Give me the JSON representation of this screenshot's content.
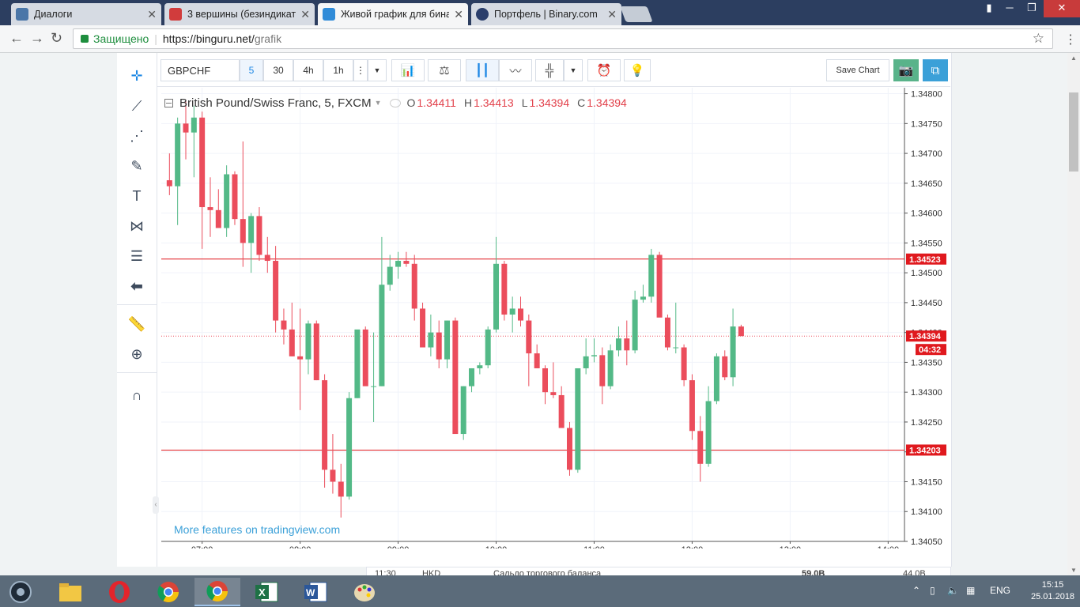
{
  "browser": {
    "tabs": [
      {
        "title": "Диалоги",
        "color": "#4a76a8",
        "active": false
      },
      {
        "title": "3 вершины (безиндикат",
        "color": "#d13c3c",
        "active": false
      },
      {
        "title": "Живой график для бина",
        "color": "#2f8bd8",
        "active": true
      },
      {
        "title": "Портфель | Binary.com",
        "color": "#2a3e6b",
        "active": false
      }
    ],
    "secure_label": "Защищено",
    "url_base": "https://binguru.net/",
    "url_path": "grafik"
  },
  "toolbar": {
    "symbol": "GBPCHF",
    "resolutions": [
      "5",
      "30",
      "4h",
      "1h"
    ],
    "active_resolution": "5",
    "save_chart_label": "Save Chart"
  },
  "legend": {
    "title": "British Pound/Swiss Franc, 5, FXCM",
    "o_label": "O",
    "o_value": "1.34411",
    "h_label": "H",
    "h_value": "1.34413",
    "l_label": "L",
    "l_value": "1.34394",
    "c_label": "C",
    "c_value": "1.34394"
  },
  "tradingview_link": "More features on tradingview.com",
  "bottom_strip": {
    "time": "11:30",
    "currency": "HKD",
    "text": "Сальдо торгового баланса",
    "v1": "59.0B",
    "v2": "44.0B"
  },
  "taskbar": {
    "lang": "ENG",
    "time": "15:15",
    "date": "25.01.2018"
  },
  "chart_data": {
    "type": "candlestick",
    "symbol": "GBPCHF",
    "interval": "5",
    "ylim": [
      1.3405,
      1.3481
    ],
    "xlim": [
      "06:35",
      "14:10"
    ],
    "y_ticks": [
      "1.34800",
      "1.34750",
      "1.34700",
      "1.34650",
      "1.34600",
      "1.34550",
      "1.34500",
      "1.34450",
      "1.34400",
      "1.34350",
      "1.34300",
      "1.34250",
      "1.34200",
      "1.34150",
      "1.34100",
      "1.34050"
    ],
    "x_ticks": [
      "07:00",
      "08:00",
      "09:00",
      "10:00",
      "11:00",
      "12:00",
      "13:00",
      "14:00"
    ],
    "grid": true,
    "colors": {
      "up": "#53b987",
      "down": "#eb4d5c",
      "level": "#e0191e",
      "price_badge": "#e0191e"
    },
    "horizontal_levels": [
      {
        "price": 1.34523,
        "label": "1.34523"
      },
      {
        "price": 1.34203,
        "label": "1.34203"
      }
    ],
    "last_price": {
      "price": 1.34394,
      "label": "1.34394",
      "countdown": "04:32"
    },
    "candles": [
      {
        "t": "06:40",
        "o": 1.34655,
        "h": 1.347,
        "l": 1.3463,
        "c": 1.34645
      },
      {
        "t": "06:45",
        "o": 1.34645,
        "h": 1.3476,
        "l": 1.3458,
        "c": 1.3475
      },
      {
        "t": "06:50",
        "o": 1.3475,
        "h": 1.3479,
        "l": 1.3469,
        "c": 1.34735
      },
      {
        "t": "06:55",
        "o": 1.34735,
        "h": 1.3478,
        "l": 1.3466,
        "c": 1.3476
      },
      {
        "t": "07:00",
        "o": 1.3476,
        "h": 1.3477,
        "l": 1.3454,
        "c": 1.3461
      },
      {
        "t": "07:05",
        "o": 1.3461,
        "h": 1.3466,
        "l": 1.3456,
        "c": 1.34605
      },
      {
        "t": "07:10",
        "o": 1.34605,
        "h": 1.3464,
        "l": 1.3458,
        "c": 1.34575
      },
      {
        "t": "07:15",
        "o": 1.34575,
        "h": 1.3468,
        "l": 1.3456,
        "c": 1.34665
      },
      {
        "t": "07:20",
        "o": 1.34665,
        "h": 1.3467,
        "l": 1.3458,
        "c": 1.3459
      },
      {
        "t": "07:25",
        "o": 1.3459,
        "h": 1.3472,
        "l": 1.3451,
        "c": 1.3455
      },
      {
        "t": "07:30",
        "o": 1.3455,
        "h": 1.346,
        "l": 1.345,
        "c": 1.34595
      },
      {
        "t": "07:35",
        "o": 1.34595,
        "h": 1.3461,
        "l": 1.3452,
        "c": 1.3453
      },
      {
        "t": "07:40",
        "o": 1.3453,
        "h": 1.3456,
        "l": 1.345,
        "c": 1.3452
      },
      {
        "t": "07:45",
        "o": 1.3452,
        "h": 1.34545,
        "l": 1.344,
        "c": 1.3442
      },
      {
        "t": "07:50",
        "o": 1.3442,
        "h": 1.3444,
        "l": 1.3438,
        "c": 1.34405
      },
      {
        "t": "07:55",
        "o": 1.34405,
        "h": 1.3445,
        "l": 1.3436,
        "c": 1.3436
      },
      {
        "t": "08:00",
        "o": 1.3436,
        "h": 1.3444,
        "l": 1.3427,
        "c": 1.34355
      },
      {
        "t": "08:05",
        "o": 1.34355,
        "h": 1.3442,
        "l": 1.3433,
        "c": 1.34415
      },
      {
        "t": "08:10",
        "o": 1.34415,
        "h": 1.3442,
        "l": 1.3432,
        "c": 1.3432
      },
      {
        "t": "08:15",
        "o": 1.3432,
        "h": 1.3433,
        "l": 1.3414,
        "c": 1.3417
      },
      {
        "t": "08:20",
        "o": 1.3417,
        "h": 1.3423,
        "l": 1.3413,
        "c": 1.3415
      },
      {
        "t": "08:25",
        "o": 1.3415,
        "h": 1.3418,
        "l": 1.3409,
        "c": 1.34125
      },
      {
        "t": "08:30",
        "o": 1.34125,
        "h": 1.343,
        "l": 1.3412,
        "c": 1.3429
      },
      {
        "t": "08:35",
        "o": 1.3429,
        "h": 1.3438,
        "l": 1.3429,
        "c": 1.34405
      },
      {
        "t": "08:40",
        "o": 1.34405,
        "h": 1.3441,
        "l": 1.3433,
        "c": 1.3431
      },
      {
        "t": "08:45",
        "o": 1.3431,
        "h": 1.344,
        "l": 1.3425,
        "c": 1.3431
      },
      {
        "t": "08:50",
        "o": 1.3431,
        "h": 1.3456,
        "l": 1.3431,
        "c": 1.3448
      },
      {
        "t": "08:55",
        "o": 1.3448,
        "h": 1.3453,
        "l": 1.3447,
        "c": 1.3451
      },
      {
        "t": "09:00",
        "o": 1.3451,
        "h": 1.34535,
        "l": 1.3449,
        "c": 1.3452
      },
      {
        "t": "09:05",
        "o": 1.3452,
        "h": 1.34535,
        "l": 1.3451,
        "c": 1.34515
      },
      {
        "t": "09:10",
        "o": 1.34515,
        "h": 1.3453,
        "l": 1.3442,
        "c": 1.3444
      },
      {
        "t": "09:15",
        "o": 1.3444,
        "h": 1.3445,
        "l": 1.3438,
        "c": 1.34375
      },
      {
        "t": "09:20",
        "o": 1.34375,
        "h": 1.3443,
        "l": 1.3436,
        "c": 1.344
      },
      {
        "t": "09:25",
        "o": 1.344,
        "h": 1.3442,
        "l": 1.3434,
        "c": 1.34355
      },
      {
        "t": "09:30",
        "o": 1.34355,
        "h": 1.3442,
        "l": 1.3434,
        "c": 1.3442
      },
      {
        "t": "09:35",
        "o": 1.3442,
        "h": 1.34425,
        "l": 1.3423,
        "c": 1.3423
      },
      {
        "t": "09:40",
        "o": 1.3423,
        "h": 1.3431,
        "l": 1.3422,
        "c": 1.3431
      },
      {
        "t": "09:45",
        "o": 1.3431,
        "h": 1.3434,
        "l": 1.343,
        "c": 1.3434
      },
      {
        "t": "09:50",
        "o": 1.3434,
        "h": 1.3435,
        "l": 1.3433,
        "c": 1.34345
      },
      {
        "t": "09:55",
        "o": 1.34345,
        "h": 1.3441,
        "l": 1.3434,
        "c": 1.34405
      },
      {
        "t": "10:00",
        "o": 1.34405,
        "h": 1.3456,
        "l": 1.344,
        "c": 1.34515
      },
      {
        "t": "10:05",
        "o": 1.34515,
        "h": 1.3452,
        "l": 1.3442,
        "c": 1.3443
      },
      {
        "t": "10:10",
        "o": 1.3443,
        "h": 1.3446,
        "l": 1.344,
        "c": 1.3444
      },
      {
        "t": "10:15",
        "o": 1.3444,
        "h": 1.3446,
        "l": 1.3441,
        "c": 1.3442
      },
      {
        "t": "10:20",
        "o": 1.3442,
        "h": 1.3443,
        "l": 1.3431,
        "c": 1.34365
      },
      {
        "t": "10:25",
        "o": 1.34365,
        "h": 1.3438,
        "l": 1.3434,
        "c": 1.3434
      },
      {
        "t": "10:30",
        "o": 1.3434,
        "h": 1.34345,
        "l": 1.3428,
        "c": 1.343
      },
      {
        "t": "10:35",
        "o": 1.343,
        "h": 1.3435,
        "l": 1.3429,
        "c": 1.34295
      },
      {
        "t": "10:40",
        "o": 1.34295,
        "h": 1.3431,
        "l": 1.3424,
        "c": 1.3424
      },
      {
        "t": "10:45",
        "o": 1.3424,
        "h": 1.3425,
        "l": 1.3416,
        "c": 1.3417
      },
      {
        "t": "10:50",
        "o": 1.3417,
        "h": 1.3434,
        "l": 1.34165,
        "c": 1.3434
      },
      {
        "t": "10:55",
        "o": 1.3434,
        "h": 1.3439,
        "l": 1.3433,
        "c": 1.3436
      },
      {
        "t": "11:00",
        "o": 1.3436,
        "h": 1.3439,
        "l": 1.3435,
        "c": 1.34362
      },
      {
        "t": "11:05",
        "o": 1.34362,
        "h": 1.34375,
        "l": 1.3428,
        "c": 1.3431
      },
      {
        "t": "11:10",
        "o": 1.3431,
        "h": 1.3438,
        "l": 1.34305,
        "c": 1.3437
      },
      {
        "t": "11:15",
        "o": 1.3437,
        "h": 1.3441,
        "l": 1.3436,
        "c": 1.3439
      },
      {
        "t": "11:20",
        "o": 1.3439,
        "h": 1.3442,
        "l": 1.34345,
        "c": 1.3437
      },
      {
        "t": "11:25",
        "o": 1.3437,
        "h": 1.3447,
        "l": 1.34365,
        "c": 1.34455
      },
      {
        "t": "11:30",
        "o": 1.34455,
        "h": 1.3448,
        "l": 1.3445,
        "c": 1.3446
      },
      {
        "t": "11:35",
        "o": 1.3446,
        "h": 1.3454,
        "l": 1.3445,
        "c": 1.3453
      },
      {
        "t": "11:40",
        "o": 1.3453,
        "h": 1.34535,
        "l": 1.3443,
        "c": 1.34425
      },
      {
        "t": "11:45",
        "o": 1.34425,
        "h": 1.3443,
        "l": 1.3437,
        "c": 1.34375
      },
      {
        "t": "11:50",
        "o": 1.34375,
        "h": 1.3445,
        "l": 1.34365,
        "c": 1.34375
      },
      {
        "t": "11:55",
        "o": 1.34375,
        "h": 1.3438,
        "l": 1.3431,
        "c": 1.3432
      },
      {
        "t": "12:00",
        "o": 1.3432,
        "h": 1.3433,
        "l": 1.3422,
        "c": 1.34235
      },
      {
        "t": "12:05",
        "o": 1.34235,
        "h": 1.3426,
        "l": 1.3415,
        "c": 1.3418
      },
      {
        "t": "12:10",
        "o": 1.3418,
        "h": 1.3431,
        "l": 1.34175,
        "c": 1.34285
      },
      {
        "t": "12:15",
        "o": 1.34285,
        "h": 1.34365,
        "l": 1.3428,
        "c": 1.3436
      },
      {
        "t": "12:20",
        "o": 1.3436,
        "h": 1.3437,
        "l": 1.3432,
        "c": 1.34325
      },
      {
        "t": "12:25",
        "o": 1.34325,
        "h": 1.3444,
        "l": 1.3431,
        "c": 1.3441
      },
      {
        "t": "12:30",
        "o": 1.3441,
        "h": 1.34413,
        "l": 1.34394,
        "c": 1.34394
      }
    ]
  }
}
